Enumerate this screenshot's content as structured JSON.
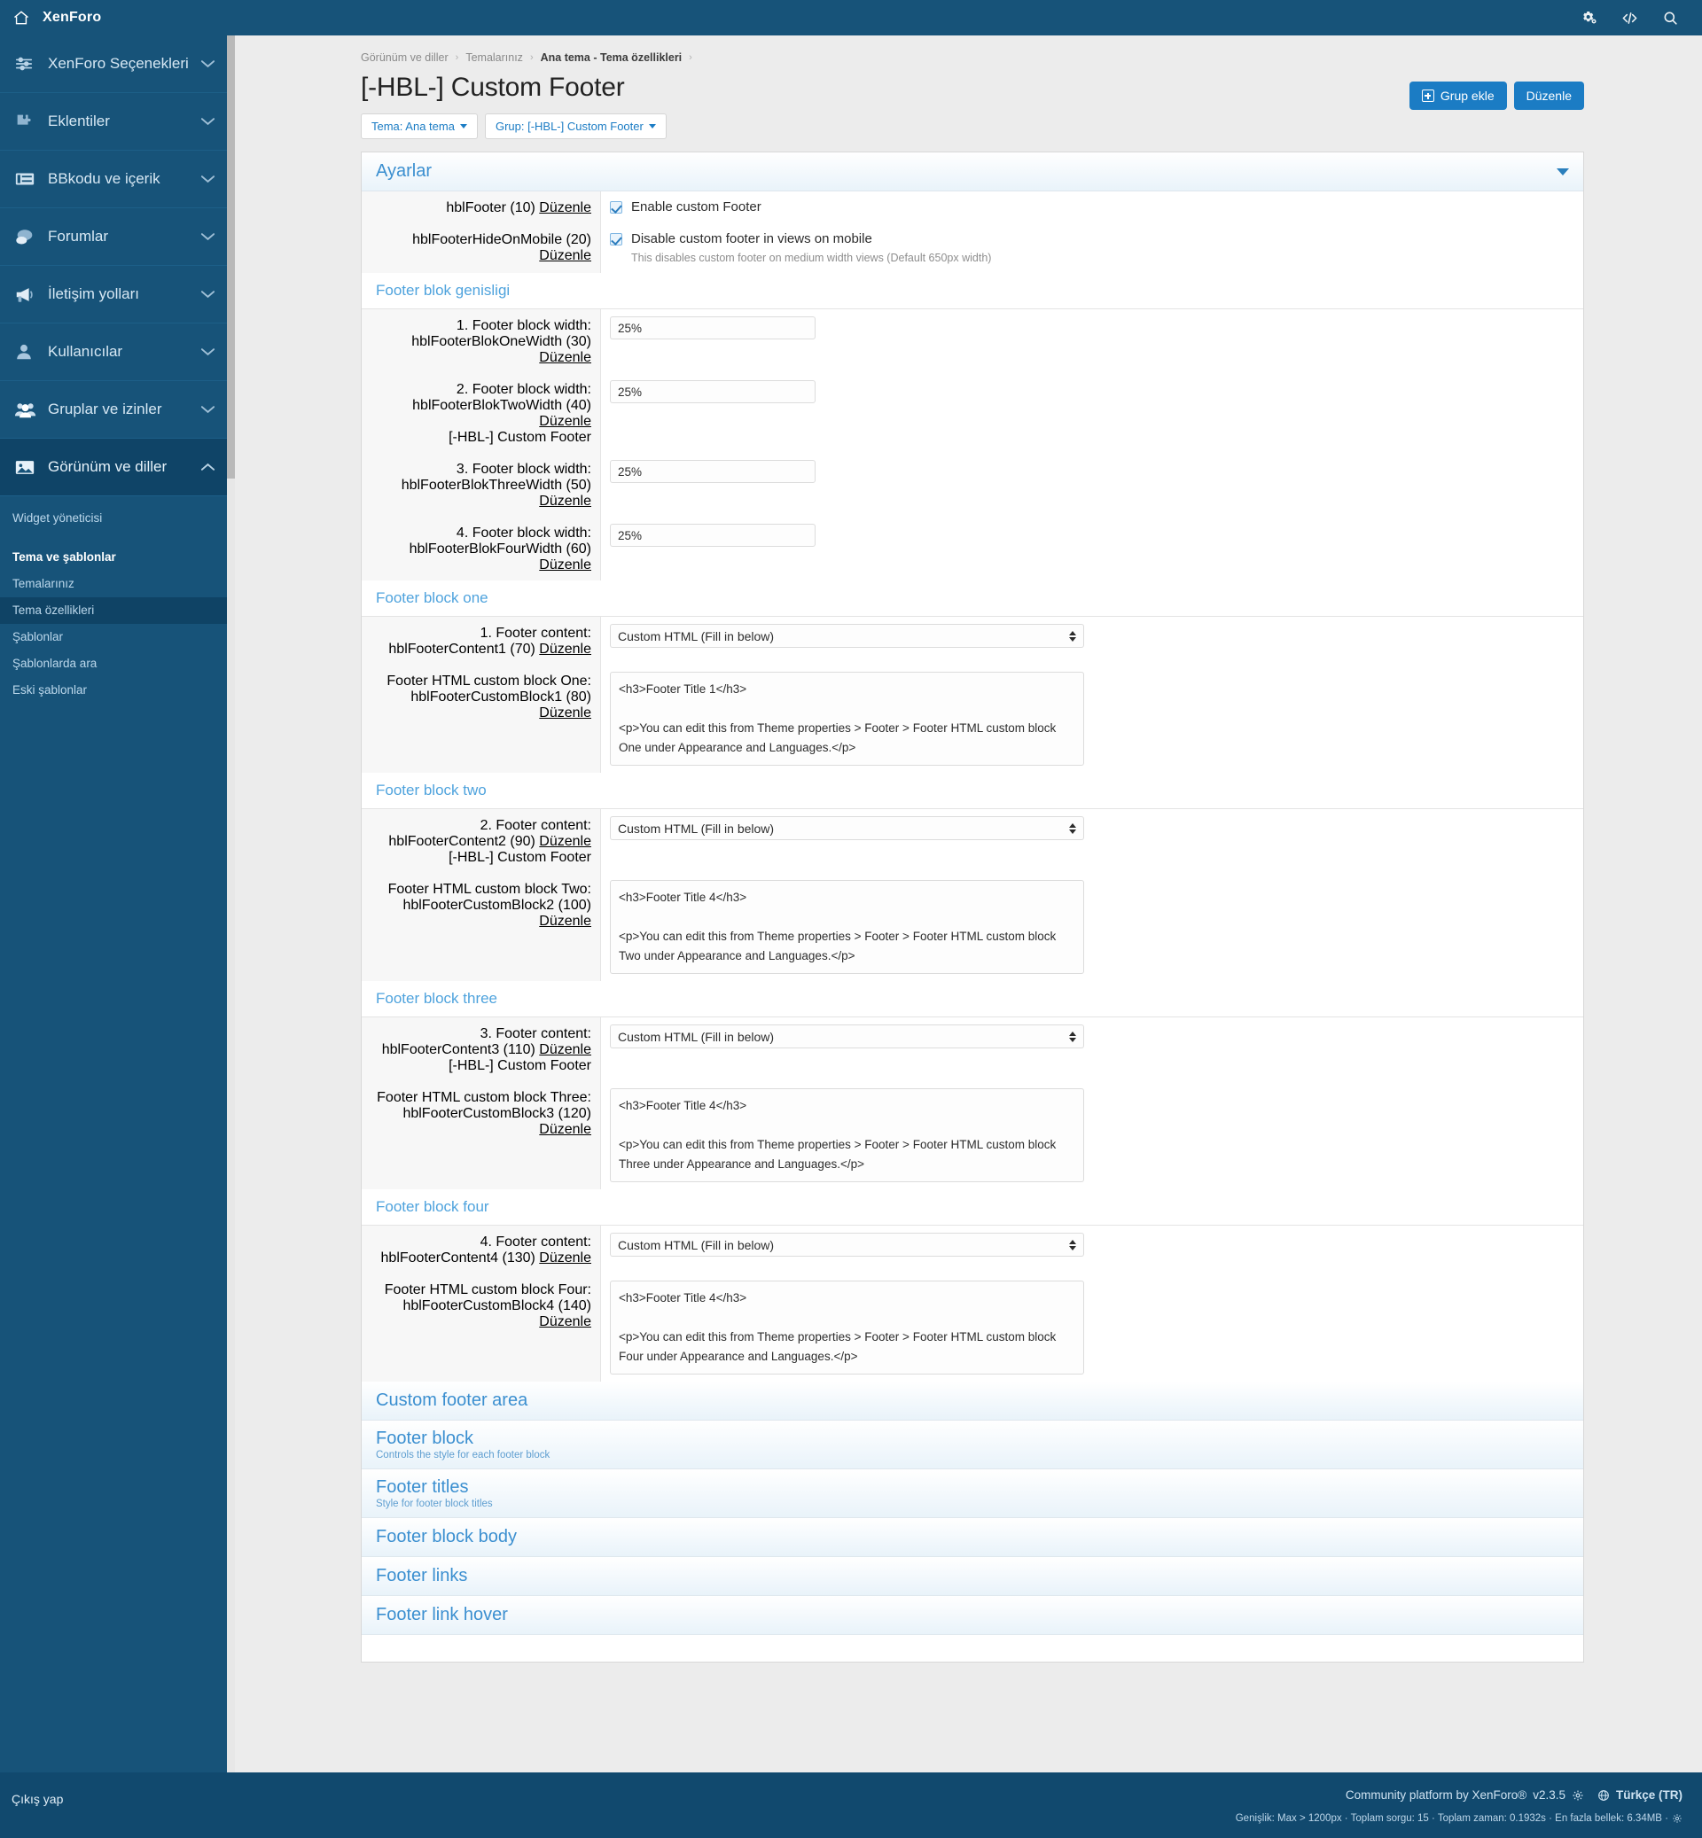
{
  "topbar": {
    "home_icon": "home-icon",
    "title": "XenForo",
    "icons": [
      "gears-icon",
      "code-icon",
      "search-icon"
    ]
  },
  "sidebar": {
    "groups": [
      {
        "label": "XenForo Seçenekleri",
        "icon": "sliders-icon",
        "chevron": "chevron-down",
        "active": false
      },
      {
        "label": "Eklentiler",
        "icon": "puzzle-icon",
        "chevron": "chevron-down",
        "active": false
      },
      {
        "label": "BBkodu ve içerik",
        "icon": "bbcode-icon",
        "chevron": "chevron-down",
        "active": false
      },
      {
        "label": "Forumlar",
        "icon": "comments-icon",
        "chevron": "chevron-down",
        "active": false
      },
      {
        "label": "İletişim yolları",
        "icon": "bullhorn-icon",
        "chevron": "chevron-down",
        "active": false
      },
      {
        "label": "Kullanıcılar",
        "icon": "user-icon",
        "chevron": "chevron-down",
        "active": false
      },
      {
        "label": "Gruplar ve izinler",
        "icon": "users-icon",
        "chevron": "chevron-down",
        "active": false
      },
      {
        "label": "Görünüm ve diller",
        "icon": "image-icon",
        "chevron": "chevron-up",
        "active": true
      }
    ],
    "sub_items": [
      {
        "label": "Widget yöneticisi",
        "bold": false,
        "selected": false
      },
      {
        "label": "Tema ve şablonlar",
        "bold": true,
        "selected": false
      },
      {
        "label": "Temalarınız",
        "bold": false,
        "selected": false
      },
      {
        "label": "Tema özellikleri",
        "bold": false,
        "selected": true
      },
      {
        "label": "Şablonlar",
        "bold": false,
        "selected": false
      },
      {
        "label": "Şablonlarda ara",
        "bold": false,
        "selected": false
      },
      {
        "label": "Eski şablonlar",
        "bold": false,
        "selected": false
      }
    ]
  },
  "breadcrumb": [
    {
      "text": "Görünüm ve diller",
      "strong": false
    },
    {
      "text": "Temalarınız",
      "strong": false
    },
    {
      "text": "Ana tema - Tema özellikleri",
      "strong": true
    }
  ],
  "page": {
    "title": "[-HBL-] Custom Footer",
    "buttons": [
      {
        "label": "Grup ekle",
        "icon": "plus-square-icon"
      },
      {
        "label": "Düzenle",
        "icon": null
      }
    ],
    "filters": [
      {
        "label": "Tema: Ana tema"
      },
      {
        "label": "Grup: [-HBL-] Custom Footer"
      }
    ]
  },
  "settings_section": {
    "title": "Ayarlar",
    "rows": [
      {
        "meta": "hblFooter (10)",
        "edit": "Düzenle",
        "checkbox_checked": true,
        "label": "Enable custom Footer",
        "desc": ""
      },
      {
        "meta": "hblFooterHideOnMobile (20)",
        "edit": "Düzenle",
        "checkbox_checked": true,
        "label": "Disable custom footer in views on mobile",
        "desc": "This disables custom footer on medium width views (Default 650px width)"
      }
    ]
  },
  "width_section": {
    "title": "Footer blok genisligi",
    "rows": [
      {
        "label": "1. Footer block width:",
        "meta": "hblFooterBlokOneWidth (30)",
        "edit": "Düzenle",
        "tag": "",
        "value": "25%"
      },
      {
        "label": "2. Footer block width:",
        "meta": "hblFooterBlokTwoWidth (40)",
        "edit": "Düzenle",
        "tag": "[-HBL-] Custom Footer",
        "value": "25%"
      },
      {
        "label": "3. Footer block width:",
        "meta": "hblFooterBlokThreeWidth (50)",
        "edit": "Düzenle",
        "tag": "",
        "value": "25%"
      },
      {
        "label": "4. Footer block width:",
        "meta": "hblFooterBlokFourWidth (60)",
        "edit": "Düzenle",
        "tag": "",
        "value": "25%"
      }
    ]
  },
  "block_sections": [
    {
      "title": "Footer block one",
      "content_row": {
        "label": "1. Footer content:",
        "meta": "hblFooterContent1 (70)",
        "edit": "Düzenle",
        "tag": "",
        "select_value": "Custom HTML (Fill in below)"
      },
      "html_row": {
        "label": "Footer HTML custom block One:",
        "meta": "hblFooterCustomBlock1 (80)",
        "edit": "Düzenle",
        "textarea": "<h3>Footer Title 1</h3>\n\n<p>You can edit this from Theme properties > Footer > Footer HTML custom block One under Appearance and Languages.</p>"
      }
    },
    {
      "title": "Footer block two",
      "content_row": {
        "label": "2. Footer content:",
        "meta": "hblFooterContent2 (90)",
        "edit": "Düzenle",
        "tag": "[-HBL-] Custom Footer",
        "select_value": "Custom HTML (Fill in below)"
      },
      "html_row": {
        "label": "Footer HTML custom block Two:",
        "meta": "hblFooterCustomBlock2 (100)",
        "edit": "Düzenle",
        "textarea": "<h3>Footer Title 4</h3>\n\n<p>You can edit this from Theme properties > Footer > Footer HTML custom block Two under Appearance and Languages.</p>"
      }
    },
    {
      "title": "Footer block three",
      "content_row": {
        "label": "3. Footer content:",
        "meta": "hblFooterContent3 (110)",
        "edit": "Düzenle",
        "tag": "[-HBL-] Custom Footer",
        "select_value": "Custom HTML (Fill in below)"
      },
      "html_row": {
        "label": "Footer HTML custom block Three:",
        "meta": "hblFooterCustomBlock3 (120)",
        "edit": "Düzenle",
        "textarea": "<h3>Footer Title 4</h3>\n\n<p>You can edit this from Theme properties > Footer > Footer HTML custom block Three under Appearance and Languages.</p>"
      }
    },
    {
      "title": "Footer block four",
      "content_row": {
        "label": "4. Footer content:",
        "meta": "hblFooterContent4 (130)",
        "edit": "Düzenle",
        "tag": "",
        "select_value": "Custom HTML (Fill in below)"
      },
      "html_row": {
        "label": "Footer HTML custom block Four:",
        "meta": "hblFooterCustomBlock4 (140)",
        "edit": "Düzenle",
        "textarea": "<h3>Footer Title 4</h3>\n\n<p>You can edit this from Theme properties > Footer > Footer HTML custom block Four under Appearance and Languages.</p>"
      }
    }
  ],
  "collapsed_sections": [
    {
      "title": "Custom footer area",
      "sub": ""
    },
    {
      "title": "Footer block",
      "sub": "Controls the style for each footer block"
    },
    {
      "title": "Footer titles",
      "sub": "Style for footer block titles"
    },
    {
      "title": "Footer block body",
      "sub": ""
    },
    {
      "title": "Footer links",
      "sub": ""
    },
    {
      "title": "Footer link hover",
      "sub": ""
    }
  ],
  "footer": {
    "logout": "Çıkış yap",
    "credit": "Community platform by XenForo®",
    "version": "v2.3.5",
    "language": "Türkçe (TR)",
    "debug": "Genişlik: Max > 1200px · Toplam sorgu: 15 · Toplam zaman: 0.1932s · En fazla bellek: 6.34MB ·"
  },
  "colors": {
    "brand_dark": "#175379",
    "accent": "#1b7cc4",
    "section_title": "#3b8fd0"
  }
}
